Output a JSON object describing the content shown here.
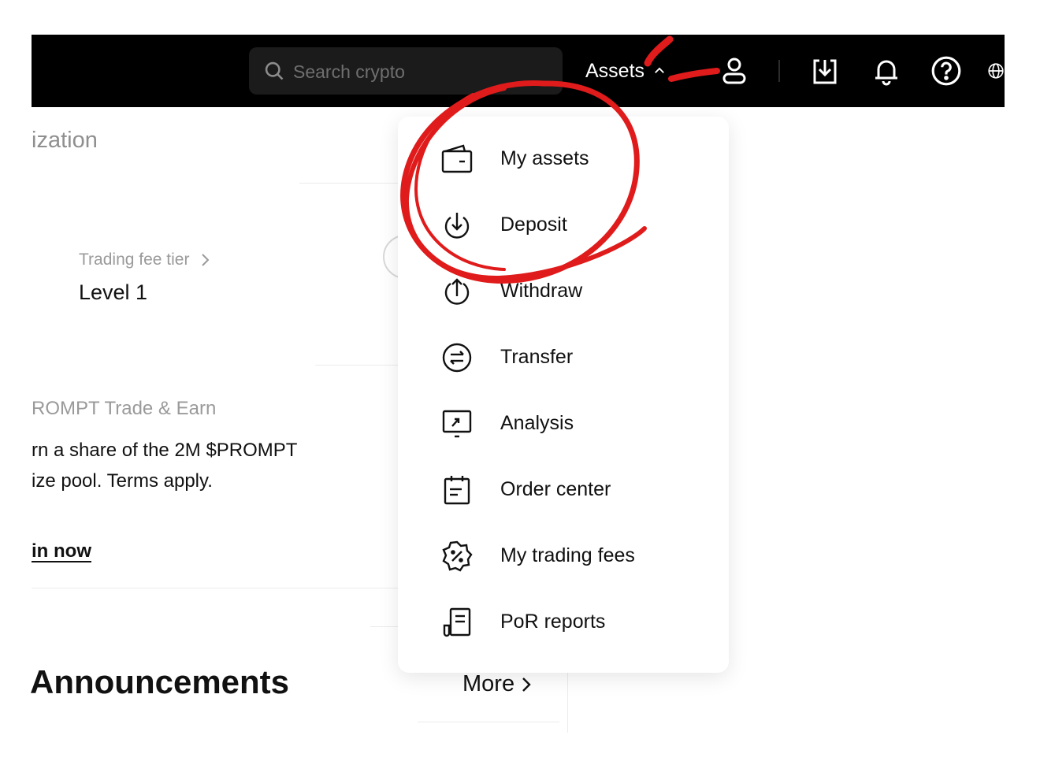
{
  "topbar": {
    "search_placeholder": "Search crypto",
    "assets_label": "Assets",
    "icons": [
      "search-icon",
      "chevron-up-icon",
      "user-icon",
      "download-app-icon",
      "bell-icon",
      "help-icon",
      "globe-icon"
    ]
  },
  "page": {
    "section_title_partial": "ization",
    "fee_tier_label": "Trading fee tier",
    "fee_tier_value": "Level 1",
    "promo_title": "ROMPT Trade & Earn",
    "promo_desc": "rn a share of the 2M $PROMPT\nize pool. Terms apply.",
    "promo_link": "in now",
    "announcements_title": "Announcements",
    "more_label": "More"
  },
  "assets_menu": {
    "items": [
      {
        "label": "My assets",
        "icon": "wallet-icon"
      },
      {
        "label": "Deposit",
        "icon": "deposit-icon"
      },
      {
        "label": "Withdraw",
        "icon": "withdraw-icon"
      },
      {
        "label": "Transfer",
        "icon": "transfer-icon"
      },
      {
        "label": "Analysis",
        "icon": "analysis-icon"
      },
      {
        "label": "Order center",
        "icon": "order-center-icon"
      },
      {
        "label": "My trading fees",
        "icon": "trading-fees-icon"
      },
      {
        "label": "PoR reports",
        "icon": "por-reports-icon"
      }
    ]
  },
  "colors": {
    "topbar_bg": "#000000",
    "annotation_red": "#e01b1b",
    "muted_text": "#9a9a9a"
  }
}
